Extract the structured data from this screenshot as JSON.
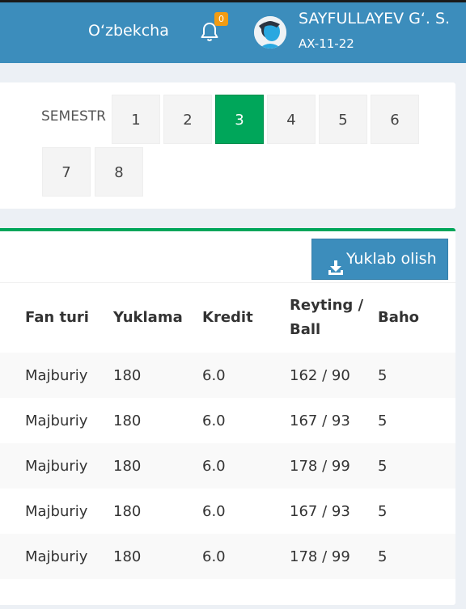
{
  "header": {
    "language": "O‘zbekcha",
    "notification_count": "0",
    "user_name": "SAYFULLAYEV G‘. S.",
    "user_group": "AX-11-22",
    "colors": {
      "bar": "#3c8dbc",
      "badge": "#f39c12"
    }
  },
  "semester": {
    "label": "SEMESTR",
    "options": [
      "1",
      "2",
      "3",
      "4",
      "5",
      "6",
      "7",
      "8"
    ],
    "selected": "3",
    "active_color": "#00a65a"
  },
  "grades": {
    "download_label": "Yuklab olish",
    "columns": {
      "type": "Fan turi",
      "load": "Yuklama",
      "credit": "Kredit",
      "rating_line1": "Reyting /",
      "rating_line2": "Ball",
      "grade": "Baho"
    },
    "rows": [
      {
        "type": "Majburiy",
        "load": "180",
        "credit": "6.0",
        "rating": "162 / 90",
        "grade": "5"
      },
      {
        "type": "Majburiy",
        "load": "180",
        "credit": "6.0",
        "rating": "167 / 93",
        "grade": "5"
      },
      {
        "type": "Majburiy",
        "load": "180",
        "credit": "6.0",
        "rating": "178 / 99",
        "grade": "5"
      },
      {
        "type": "Majburiy",
        "load": "180",
        "credit": "6.0",
        "rating": "167 / 93",
        "grade": "5"
      },
      {
        "type": "Majburiy",
        "load": "180",
        "credit": "6.0",
        "rating": "178 / 99",
        "grade": "5"
      }
    ]
  }
}
